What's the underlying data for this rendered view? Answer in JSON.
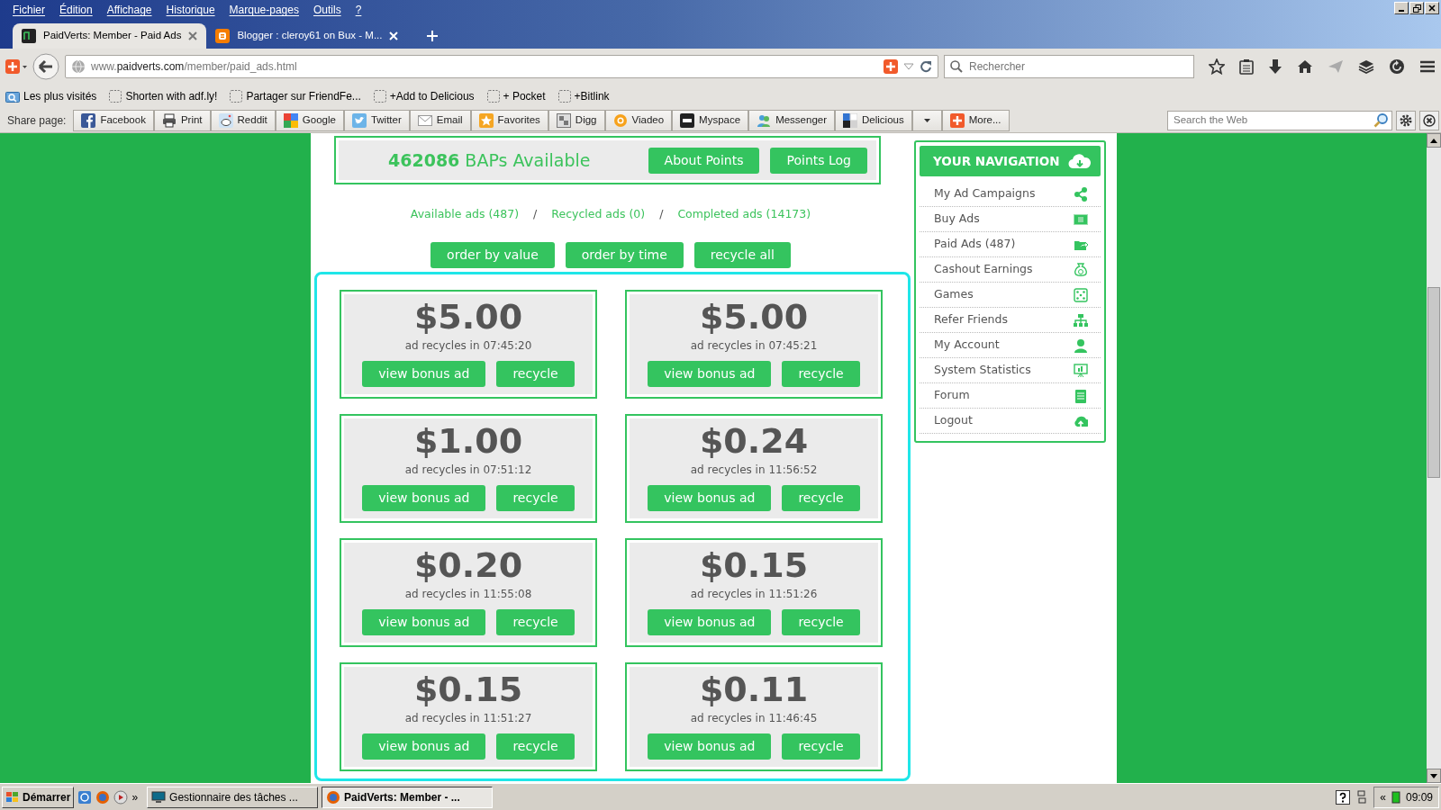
{
  "menu_bar": [
    "Fichier",
    "Édition",
    "Affichage",
    "Historique",
    "Marque-pages",
    "Outils",
    "?"
  ],
  "tabs": [
    {
      "title": "PaidVerts: Member - Paid Ads",
      "selected": true
    },
    {
      "title": "Blogger : cleroy61 on Bux - M...",
      "selected": false
    }
  ],
  "address_bar": {
    "prefix": "www.",
    "domain": "paidverts.com",
    "path": "/member/paid_ads.html"
  },
  "search_field": {
    "placeholder": "Rechercher"
  },
  "bookmarks": [
    "Les plus visités",
    "Shorten with adf.ly!",
    "Partager sur FriendFe...",
    "+Add to Delicious",
    "+ Pocket",
    "+Bitlink"
  ],
  "share_bar": {
    "label": "Share page:",
    "buttons": [
      "Facebook",
      "Print",
      "Reddit",
      "Google",
      "Twitter",
      "Email",
      "Favorites",
      "Digg",
      "Viadeo",
      "Myspace",
      "Messenger",
      "Delicious",
      "More..."
    ],
    "search_placeholder": "Search the Web"
  },
  "points": {
    "count": "462086",
    "label": "BAPs Available",
    "buttons": [
      "About Points",
      "Points Log"
    ]
  },
  "ad_filters": [
    {
      "label": "Available ads (487)"
    },
    {
      "label": "Recycled ads (0)"
    },
    {
      "label": "Completed ads (14173)"
    }
  ],
  "separators": [
    "/",
    "/"
  ],
  "order_buttons": [
    "order by value",
    "order by time",
    "recycle all"
  ],
  "ads": [
    {
      "amount": "$5.00",
      "recycles": "ad recycles in 07:45:20",
      "view": "view bonus ad",
      "recycle": "recycle"
    },
    {
      "amount": "$5.00",
      "recycles": "ad recycles in 07:45:21",
      "view": "view bonus ad",
      "recycle": "recycle"
    },
    {
      "amount": "$1.00",
      "recycles": "ad recycles in 07:51:12",
      "view": "view bonus ad",
      "recycle": "recycle"
    },
    {
      "amount": "$0.24",
      "recycles": "ad recycles in 11:56:52",
      "view": "view bonus ad",
      "recycle": "recycle"
    },
    {
      "amount": "$0.20",
      "recycles": "ad recycles in 11:55:08",
      "view": "view bonus ad",
      "recycle": "recycle"
    },
    {
      "amount": "$0.15",
      "recycles": "ad recycles in 11:51:26",
      "view": "view bonus ad",
      "recycle": "recycle"
    },
    {
      "amount": "$0.15",
      "recycles": "ad recycles in 11:51:27",
      "view": "view bonus ad",
      "recycle": "recycle"
    },
    {
      "amount": "$0.11",
      "recycles": "ad recycles in 11:46:45",
      "view": "view bonus ad",
      "recycle": "recycle"
    }
  ],
  "navigation": {
    "title": "YOUR NAVIGATION",
    "items": [
      "My Ad Campaigns",
      "Buy Ads",
      "Paid Ads (487)",
      "Cashout Earnings",
      "Games",
      "Refer Friends",
      "My Account",
      "System Statistics",
      "Forum",
      "Logout"
    ]
  },
  "taskbar": {
    "start": "Démarrer",
    "more": "»",
    "tasks": [
      {
        "title": "Gestionnaire des tâches ...",
        "selected": false
      },
      {
        "title": "PaidVerts: Member - ...",
        "selected": true
      }
    ],
    "tray_toggle": "«",
    "clock": "09:09"
  }
}
